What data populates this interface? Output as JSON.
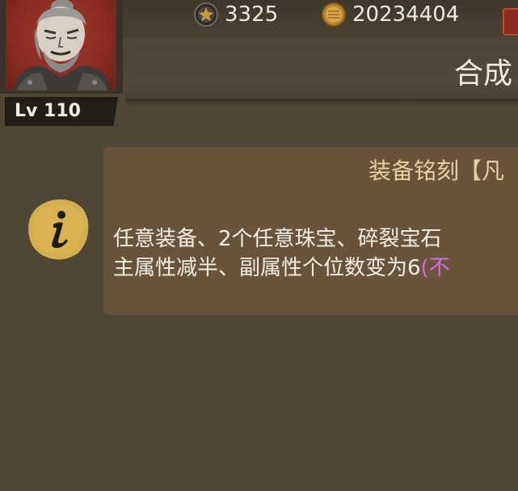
{
  "player": {
    "level_label": "Lv 110"
  },
  "resources": {
    "star_icon": "star-coin-icon",
    "star_value": "3325",
    "gold_icon": "gold-coin-icon",
    "gold_value": "20234404"
  },
  "header": {
    "title": "合成"
  },
  "info": {
    "icon": "info-icon",
    "title": "装备铭刻【凡",
    "line1": "任意装备、2个任意珠宝、碎裂宝石",
    "line2_main": "主属性减半、副属性个位数变为6",
    "line2_suffix": "(不"
  },
  "colors": {
    "background": "#4f4636",
    "panel": "#69543b",
    "panel_title": "#e7cfa4",
    "highlight": "#d26bd9",
    "avatar_bg": "#8b2c23"
  }
}
